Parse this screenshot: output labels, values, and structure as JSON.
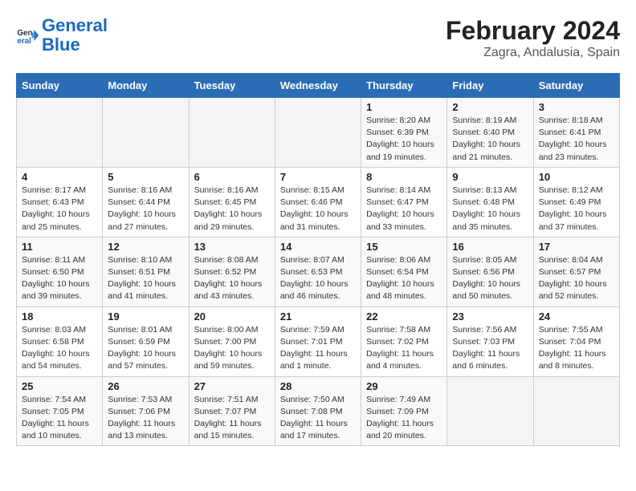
{
  "logo": {
    "general": "General",
    "blue": "Blue"
  },
  "title": "February 2024",
  "subtitle": "Zagra, Andalusia, Spain",
  "weekdays": [
    "Sunday",
    "Monday",
    "Tuesday",
    "Wednesday",
    "Thursday",
    "Friday",
    "Saturday"
  ],
  "weeks": [
    [
      {
        "day": "",
        "info": ""
      },
      {
        "day": "",
        "info": ""
      },
      {
        "day": "",
        "info": ""
      },
      {
        "day": "",
        "info": ""
      },
      {
        "day": "1",
        "info": "Sunrise: 8:20 AM\nSunset: 6:39 PM\nDaylight: 10 hours\nand 19 minutes."
      },
      {
        "day": "2",
        "info": "Sunrise: 8:19 AM\nSunset: 6:40 PM\nDaylight: 10 hours\nand 21 minutes."
      },
      {
        "day": "3",
        "info": "Sunrise: 8:18 AM\nSunset: 6:41 PM\nDaylight: 10 hours\nand 23 minutes."
      }
    ],
    [
      {
        "day": "4",
        "info": "Sunrise: 8:17 AM\nSunset: 6:43 PM\nDaylight: 10 hours\nand 25 minutes."
      },
      {
        "day": "5",
        "info": "Sunrise: 8:16 AM\nSunset: 6:44 PM\nDaylight: 10 hours\nand 27 minutes."
      },
      {
        "day": "6",
        "info": "Sunrise: 8:16 AM\nSunset: 6:45 PM\nDaylight: 10 hours\nand 29 minutes."
      },
      {
        "day": "7",
        "info": "Sunrise: 8:15 AM\nSunset: 6:46 PM\nDaylight: 10 hours\nand 31 minutes."
      },
      {
        "day": "8",
        "info": "Sunrise: 8:14 AM\nSunset: 6:47 PM\nDaylight: 10 hours\nand 33 minutes."
      },
      {
        "day": "9",
        "info": "Sunrise: 8:13 AM\nSunset: 6:48 PM\nDaylight: 10 hours\nand 35 minutes."
      },
      {
        "day": "10",
        "info": "Sunrise: 8:12 AM\nSunset: 6:49 PM\nDaylight: 10 hours\nand 37 minutes."
      }
    ],
    [
      {
        "day": "11",
        "info": "Sunrise: 8:11 AM\nSunset: 6:50 PM\nDaylight: 10 hours\nand 39 minutes."
      },
      {
        "day": "12",
        "info": "Sunrise: 8:10 AM\nSunset: 6:51 PM\nDaylight: 10 hours\nand 41 minutes."
      },
      {
        "day": "13",
        "info": "Sunrise: 8:08 AM\nSunset: 6:52 PM\nDaylight: 10 hours\nand 43 minutes."
      },
      {
        "day": "14",
        "info": "Sunrise: 8:07 AM\nSunset: 6:53 PM\nDaylight: 10 hours\nand 46 minutes."
      },
      {
        "day": "15",
        "info": "Sunrise: 8:06 AM\nSunset: 6:54 PM\nDaylight: 10 hours\nand 48 minutes."
      },
      {
        "day": "16",
        "info": "Sunrise: 8:05 AM\nSunset: 6:56 PM\nDaylight: 10 hours\nand 50 minutes."
      },
      {
        "day": "17",
        "info": "Sunrise: 8:04 AM\nSunset: 6:57 PM\nDaylight: 10 hours\nand 52 minutes."
      }
    ],
    [
      {
        "day": "18",
        "info": "Sunrise: 8:03 AM\nSunset: 6:58 PM\nDaylight: 10 hours\nand 54 minutes."
      },
      {
        "day": "19",
        "info": "Sunrise: 8:01 AM\nSunset: 6:59 PM\nDaylight: 10 hours\nand 57 minutes."
      },
      {
        "day": "20",
        "info": "Sunrise: 8:00 AM\nSunset: 7:00 PM\nDaylight: 10 hours\nand 59 minutes."
      },
      {
        "day": "21",
        "info": "Sunrise: 7:59 AM\nSunset: 7:01 PM\nDaylight: 11 hours\nand 1 minute."
      },
      {
        "day": "22",
        "info": "Sunrise: 7:58 AM\nSunset: 7:02 PM\nDaylight: 11 hours\nand 4 minutes."
      },
      {
        "day": "23",
        "info": "Sunrise: 7:56 AM\nSunset: 7:03 PM\nDaylight: 11 hours\nand 6 minutes."
      },
      {
        "day": "24",
        "info": "Sunrise: 7:55 AM\nSunset: 7:04 PM\nDaylight: 11 hours\nand 8 minutes."
      }
    ],
    [
      {
        "day": "25",
        "info": "Sunrise: 7:54 AM\nSunset: 7:05 PM\nDaylight: 11 hours\nand 10 minutes."
      },
      {
        "day": "26",
        "info": "Sunrise: 7:53 AM\nSunset: 7:06 PM\nDaylight: 11 hours\nand 13 minutes."
      },
      {
        "day": "27",
        "info": "Sunrise: 7:51 AM\nSunset: 7:07 PM\nDaylight: 11 hours\nand 15 minutes."
      },
      {
        "day": "28",
        "info": "Sunrise: 7:50 AM\nSunset: 7:08 PM\nDaylight: 11 hours\nand 17 minutes."
      },
      {
        "day": "29",
        "info": "Sunrise: 7:49 AM\nSunset: 7:09 PM\nDaylight: 11 hours\nand 20 minutes."
      },
      {
        "day": "",
        "info": ""
      },
      {
        "day": "",
        "info": ""
      }
    ]
  ]
}
